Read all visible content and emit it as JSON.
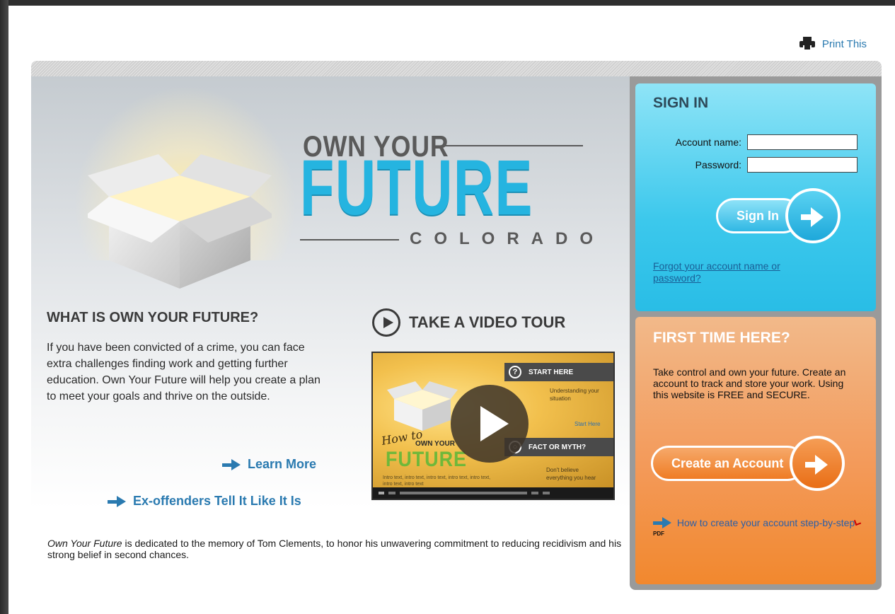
{
  "header": {
    "print_label": "Print This"
  },
  "hero": {
    "logo_own": "OWN YOUR",
    "logo_future": "FUTURE",
    "logo_state": "COLORADO"
  },
  "what": {
    "title": "WHAT IS OWN YOUR FUTURE?",
    "body": "If you have been convicted of a crime, you can face extra challenges finding work and getting further education. Own Your Future will help you create a plan to meet your goals and thrive on the outside.",
    "learn_more": "Learn More",
    "ex_offenders": "Ex-offenders Tell It Like It Is"
  },
  "video": {
    "title": "TAKE A VIDEO TOUR",
    "panel1": "START HERE",
    "panel1_text": "Understanding your situation",
    "panel1_link": "Start Here",
    "panel2": "FACT OR MYTH?",
    "panel2_text": "Don't believe everything you hear",
    "how_to": "How to",
    "own_your": "OWN YOUR",
    "future": "FUTURE",
    "intro_text": "Intro text, intro text, intro text, intro text, intro text, intro text, intro text"
  },
  "dedication": {
    "italic": "Own Your Future",
    "rest": " is dedicated to the memory of Tom Clements, to honor his unwavering commitment to reducing recidivism and his strong belief in second chances."
  },
  "signin": {
    "title": "SIGN IN",
    "account_label": "Account name:",
    "password_label": "Password:",
    "account_value": "",
    "password_value": "",
    "button_label": "Sign In",
    "forgot_link": "Forgot your account name or password?"
  },
  "first_time": {
    "title": "FIRST TIME HERE?",
    "body": "Take control and own your future. Create an account to track and store your work. Using this website is FREE and SECURE.",
    "button_label": "Create an Account",
    "howto_link": "How to create your account step-by-step",
    "pdf_label": "PDF"
  },
  "colors": {
    "accent_blue": "#2a7ab0",
    "signin_cyan": "#3cc8ec",
    "firsttime_orange": "#f39a5a",
    "logo_cyan": "#25b4e0"
  }
}
